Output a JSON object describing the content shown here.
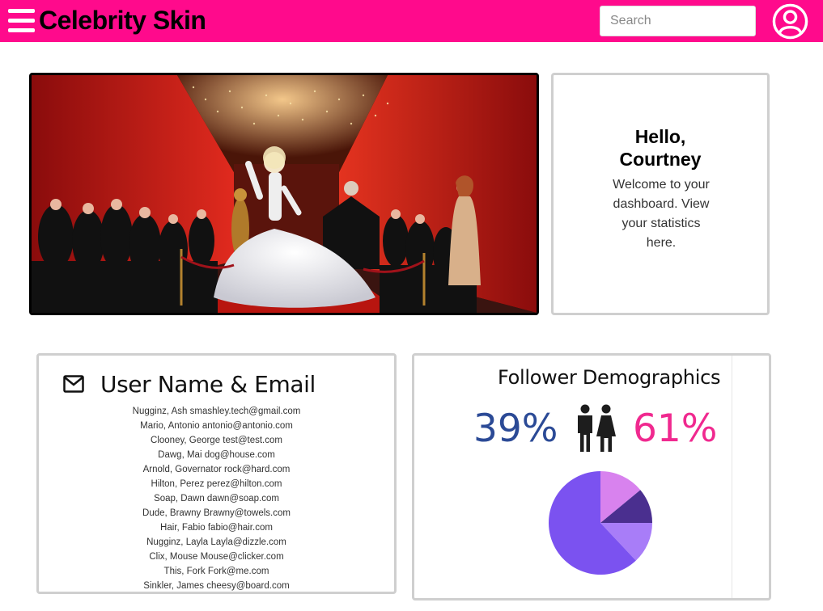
{
  "header": {
    "title": "Celebrity Skin",
    "search_placeholder": "Search",
    "brand_color": "#ff0a8c",
    "menu_icon": "hamburger-menu-icon",
    "avatar_icon": "user-avatar-icon"
  },
  "hero": {
    "image": "photo-red-carpet-event"
  },
  "welcome": {
    "greeting_line1": "Hello,",
    "greeting_line2": "Courtney",
    "message": "Welcome to your dashboard. View your statistics here."
  },
  "users": {
    "title": "User Name & Email",
    "icon": "mail-icon",
    "rows": [
      "Nugginz, Ash smashley.tech@gmail.com",
      "Mario, Antonio antonio@antonio.com",
      "Clooney, George test@test.com",
      "Dawg, Mai dog@house.com",
      "Arnold, Governator rock@hard.com",
      "Hilton, Perez perez@hilton.com",
      "Soap, Dawn dawn@soap.com",
      "Dude, Brawny Brawny@towels.com",
      "Hair, Fabio fabio@hair.com",
      "Nugginz, Layla Layla@dizzle.com",
      "Clix, Mouse Mouse@clicker.com",
      "This, Fork Fork@me.com",
      "Sinkler, James cheesy@board.com"
    ]
  },
  "demographics": {
    "title": "Follower Demographics",
    "male_percent": "39%",
    "female_percent": "61%",
    "male_color": "#2b4a96",
    "female_color": "#f0298f",
    "gender_icon": "male-female-icon",
    "pie_slices": [
      {
        "value": 14,
        "color": "#d882ee"
      },
      {
        "value": 11,
        "color": "#4a2f8f"
      },
      {
        "value": 13,
        "color": "#a87df8"
      },
      {
        "value": 62,
        "color": "#7b52f0"
      }
    ]
  }
}
